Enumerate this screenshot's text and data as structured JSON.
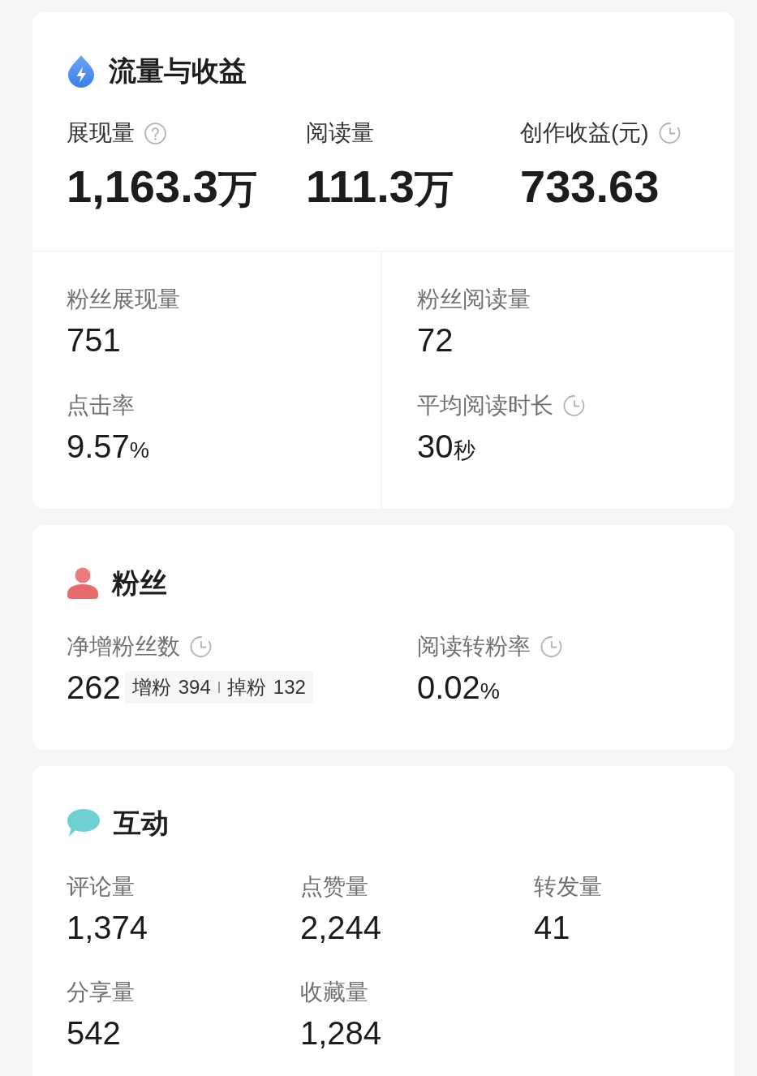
{
  "sections": [
    {
      "kind": "traffic",
      "title": "流量与收益",
      "headline": [
        {
          "label": "展现量",
          "kind": "help",
          "value": "1,163.3",
          "unit": "万"
        },
        {
          "label": "阅读量",
          "kind": "plain",
          "value": "111.3",
          "unit": "万"
        },
        {
          "label": "创作收益(元)",
          "kind": "timed",
          "value": "733.63"
        }
      ],
      "metrics": [
        {
          "label": "粉丝展现量",
          "kind": "plain",
          "value": "751"
        },
        {
          "label": "粉丝阅读量",
          "kind": "plain",
          "value": "72"
        },
        {
          "label": "点击率",
          "kind": "plain",
          "value": "9.57",
          "unit": "%"
        },
        {
          "label": "平均阅读时长",
          "kind": "timed",
          "value": "30",
          "unit": "秒"
        }
      ]
    },
    {
      "kind": "fans",
      "title": "粉丝",
      "metrics": [
        {
          "label": "净增粉丝数",
          "kind": "timed",
          "value": "262",
          "breakdown": [
            {
              "label": "增粉",
              "value": "394"
            },
            {
              "label": "掉粉",
              "value": "132"
            }
          ]
        },
        {
          "label": "阅读转粉率",
          "kind": "timed",
          "value": "0.02",
          "unit": "%"
        }
      ]
    },
    {
      "kind": "interaction",
      "title": "互动",
      "metrics": [
        {
          "label": "评论量",
          "kind": "plain",
          "value": "1,374"
        },
        {
          "label": "点赞量",
          "kind": "plain",
          "value": "2,244"
        },
        {
          "label": "转发量",
          "kind": "plain",
          "value": "41"
        },
        {
          "label": "分享量",
          "kind": "plain",
          "value": "542"
        },
        {
          "label": "收藏量",
          "kind": "plain",
          "value": "1,284"
        }
      ]
    }
  ]
}
